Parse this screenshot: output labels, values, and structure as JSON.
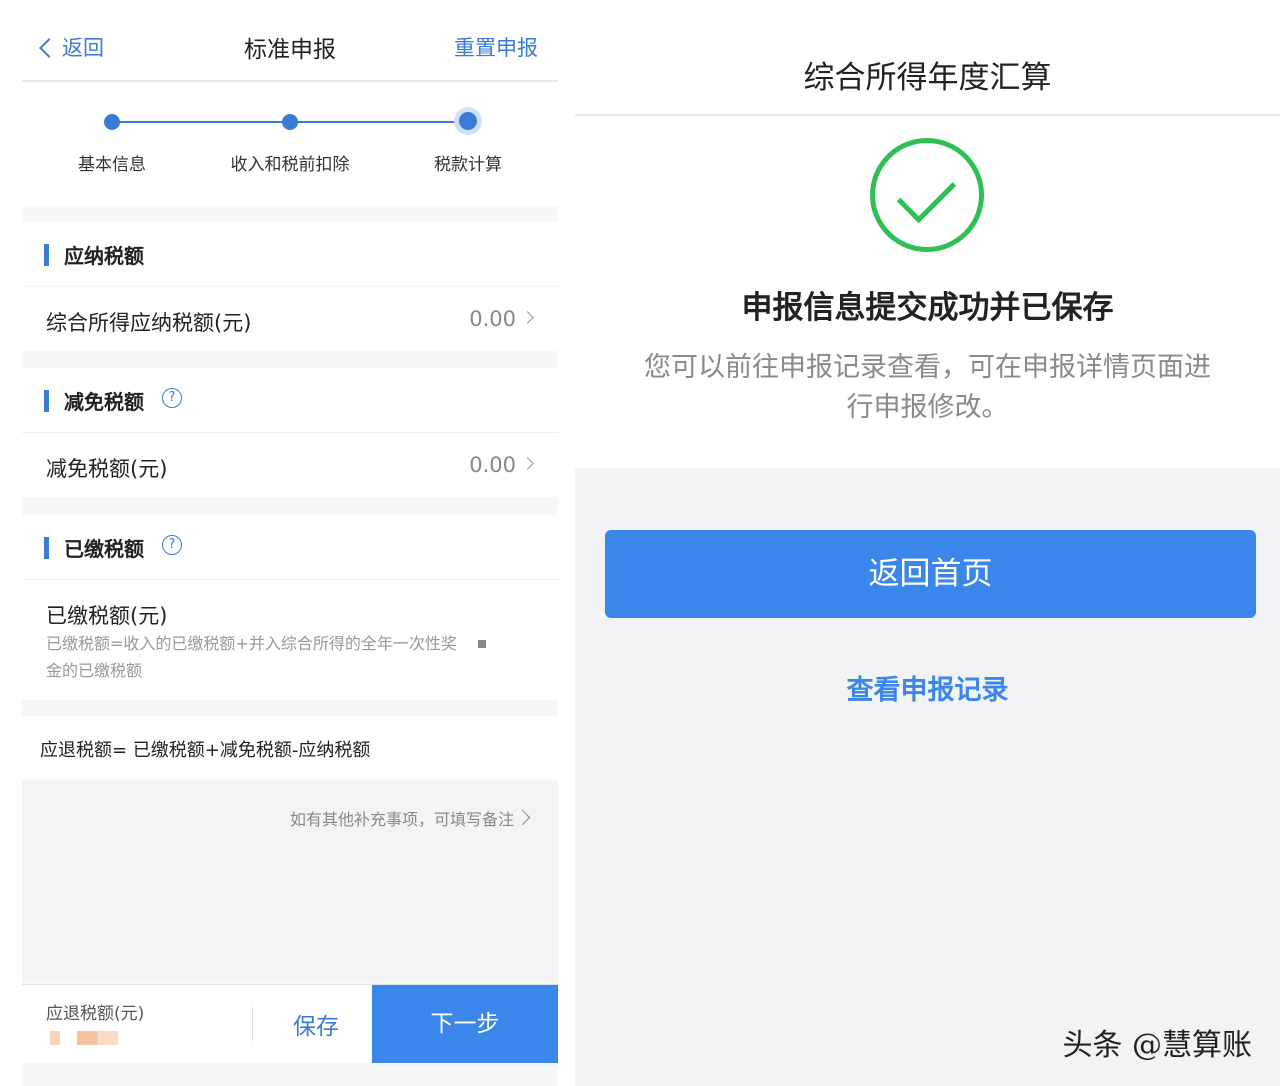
{
  "left": {
    "nav": {
      "back_label": "返回",
      "title": "标准申报",
      "reset_label": "重置申报"
    },
    "steps": [
      {
        "label": "基本信息",
        "state": "done"
      },
      {
        "label": "收入和税前扣除",
        "state": "done"
      },
      {
        "label": "税款计算",
        "state": "current"
      }
    ],
    "section_payable": {
      "title": "应纳税额",
      "row_label": "综合所得应纳税额(元)",
      "row_value": "0.00"
    },
    "section_reduction": {
      "title": "减免税额",
      "row_label": "减免税额(元)",
      "row_value": "0.00"
    },
    "section_paid": {
      "title": "已缴税额",
      "row_label": "已缴税额(元)",
      "row_desc": "已缴税额=收入的已缴税额+并入综合所得的全年一次性奖金的已缴税额"
    },
    "formula": "应退税额= 已缴税额+减免税额-应纳税额",
    "remark_hint": "如有其他补充事项，可填写备注",
    "bottom": {
      "refund_label": "应退税额(元)",
      "save_label": "保存",
      "next_label": "下一步"
    }
  },
  "right": {
    "title": "综合所得年度汇算",
    "success_title": "申报信息提交成功并已保存",
    "success_desc": "您可以前往申报记录查看，可在申报详情页面进行申报修改。",
    "home_button": "返回首页",
    "records_link": "查看申报记录",
    "watermark": "头条 @慧算账"
  },
  "colors": {
    "accent": "#3a86ea",
    "success": "#2fbf55"
  }
}
